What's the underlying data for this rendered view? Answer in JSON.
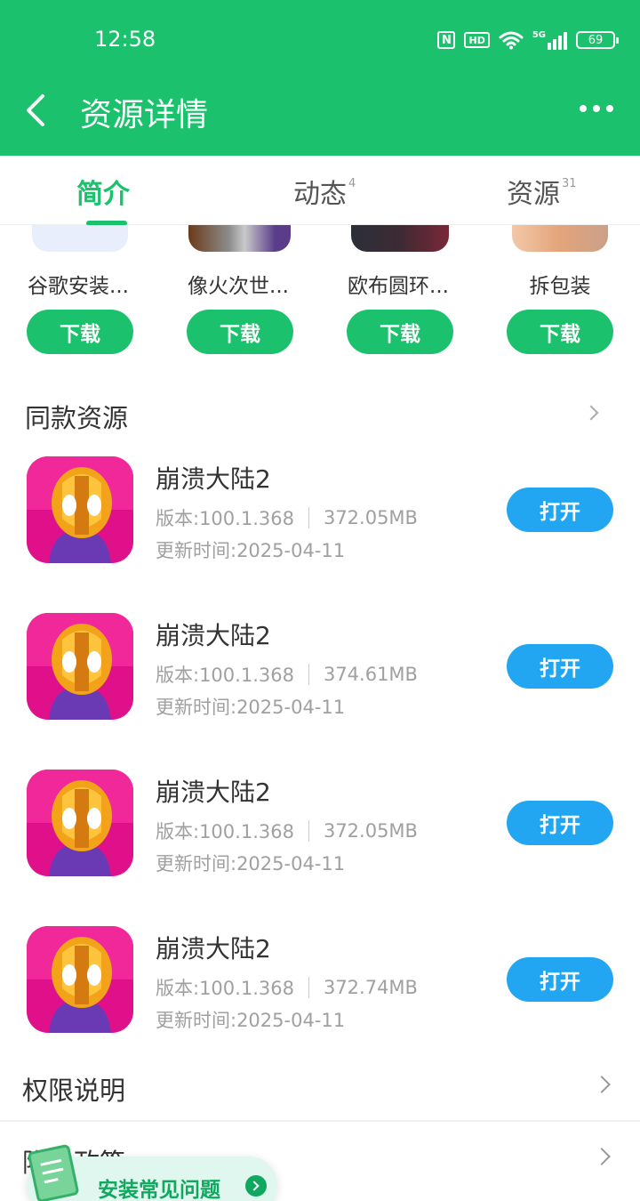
{
  "status_bar": {
    "time": "12:58",
    "nfc": "N",
    "hd": "HD",
    "network": "5G",
    "battery": "69"
  },
  "header": {
    "title": "资源详情",
    "back_icon": "chevron-left-icon",
    "more_icon": "more-dots-icon"
  },
  "tabs": [
    {
      "label": "简介",
      "badge": "",
      "active": true
    },
    {
      "label": "动态",
      "badge": "4",
      "active": false
    },
    {
      "label": "资源",
      "badge": "31",
      "active": false
    }
  ],
  "recommended": [
    {
      "name": "谷歌安装...",
      "button": "下载"
    },
    {
      "name": "像火次世...",
      "button": "下载"
    },
    {
      "name": "欧布圆环...",
      "button": "下载"
    },
    {
      "name": "拆包装",
      "button": "下载"
    }
  ],
  "same_resources": {
    "title": "同款资源",
    "items": [
      {
        "name": "崩溃大陆2",
        "version": "版本:100.1.368",
        "size": "372.05MB",
        "updated": "更新时间:2025-04-11",
        "button": "打开"
      },
      {
        "name": "崩溃大陆2",
        "version": "版本:100.1.368",
        "size": "374.61MB",
        "updated": "更新时间:2025-04-11",
        "button": "打开"
      },
      {
        "name": "崩溃大陆2",
        "version": "版本:100.1.368",
        "size": "372.05MB",
        "updated": "更新时间:2025-04-11",
        "button": "打开"
      },
      {
        "name": "崩溃大陆2",
        "version": "版本:100.1.368",
        "size": "372.74MB",
        "updated": "更新时间:2025-04-11",
        "button": "打开"
      }
    ]
  },
  "sections": {
    "permissions": "权限说明",
    "privacy": "隐私政策"
  },
  "faq": {
    "label": "安装常见问题"
  },
  "colors": {
    "brand_green": "#1bc16c",
    "open_blue": "#22a6f2",
    "secondary_text": "#a0a0a0"
  }
}
